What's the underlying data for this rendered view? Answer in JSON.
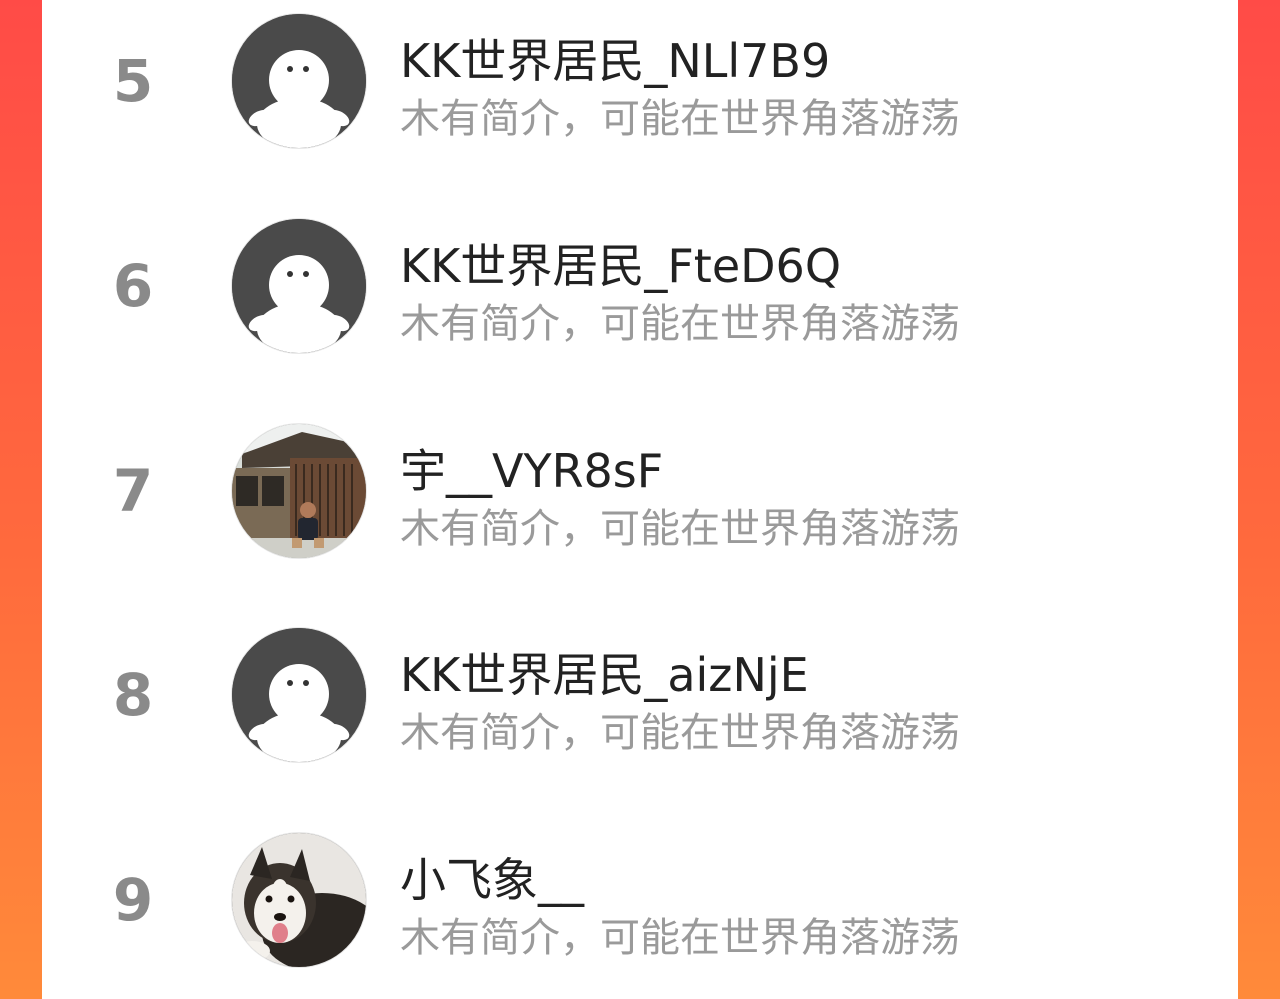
{
  "list": {
    "rows": [
      {
        "rank": "5",
        "name": "KK世界居民_NLl7B9",
        "bio": "木有简介，可能在世界角落游荡",
        "avatar": "default-avatar-icon"
      },
      {
        "rank": "6",
        "name": "KK世界居民_FteD6Q",
        "bio": "木有简介，可能在世界角落游荡",
        "avatar": "default-avatar-icon"
      },
      {
        "rank": "7",
        "name": "宇__VYR8sF",
        "bio": "木有简介，可能在世界角落游荡",
        "avatar": "photo-avatar-house"
      },
      {
        "rank": "8",
        "name": "KK世界居民_aizNjE",
        "bio": "木有简介，可能在世界角落游荡",
        "avatar": "default-avatar-icon"
      },
      {
        "rank": "9",
        "name": "小飞象__",
        "bio": "木有简介，可能在世界角落游荡",
        "avatar": "photo-avatar-dog"
      }
    ]
  },
  "colors": {
    "background_gradient_top": "#ff4b47",
    "background_gradient_bottom": "#ff8a3a",
    "panel": "#ffffff",
    "rank_text": "#8a8a8a",
    "name_text": "#222222",
    "bio_text": "#9a9a9a",
    "default_avatar_bg": "#4a4a4a"
  }
}
